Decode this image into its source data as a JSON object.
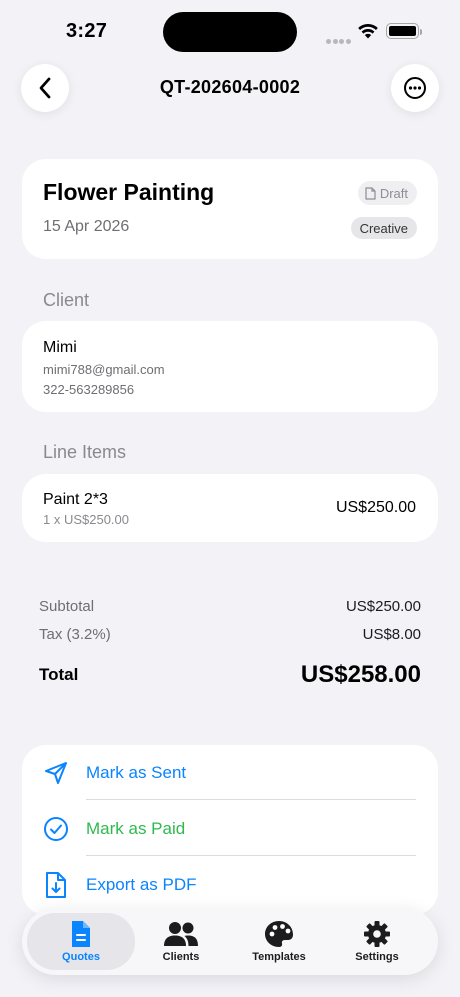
{
  "status": {
    "time": "3:27"
  },
  "nav": {
    "title": "QT-202604-0002"
  },
  "quote": {
    "title": "Flower Painting",
    "date": "15 Apr 2026",
    "status_badge": "Draft",
    "category_badge": "Creative"
  },
  "client": {
    "section_label": "Client",
    "name": "Mimi",
    "email": "mimi788@gmail.com",
    "phone": "322-563289856"
  },
  "line_items": {
    "section_label": "Line Items",
    "items": [
      {
        "name": "Paint 2*3",
        "detail": "1 x US$250.00",
        "amount": "US$250.00"
      }
    ]
  },
  "totals": {
    "subtotal_label": "Subtotal",
    "subtotal_value": "US$250.00",
    "tax_label": "Tax (3.2%)",
    "tax_value": "US$8.00",
    "total_label": "Total",
    "total_value": "US$258.00"
  },
  "actions": [
    {
      "label": "Mark as Sent",
      "icon": "paper-plane-icon",
      "color": "#0a84ff"
    },
    {
      "label": "Mark as Paid",
      "icon": "checkmark-circle-icon",
      "color": "#30b84f"
    },
    {
      "label": "Export as PDF",
      "icon": "document-download-icon",
      "color": "#0a84ff"
    }
  ],
  "tabbar": {
    "tabs": [
      {
        "label": "Quotes",
        "icon": "document-icon",
        "active": true
      },
      {
        "label": "Clients",
        "icon": "people-icon",
        "active": false
      },
      {
        "label": "Templates",
        "icon": "palette-icon",
        "active": false
      },
      {
        "label": "Settings",
        "icon": "gear-icon",
        "active": false
      }
    ]
  },
  "colors": {
    "accent": "#0a84ff",
    "success": "#30b84f",
    "background": "#f2f2f7"
  }
}
